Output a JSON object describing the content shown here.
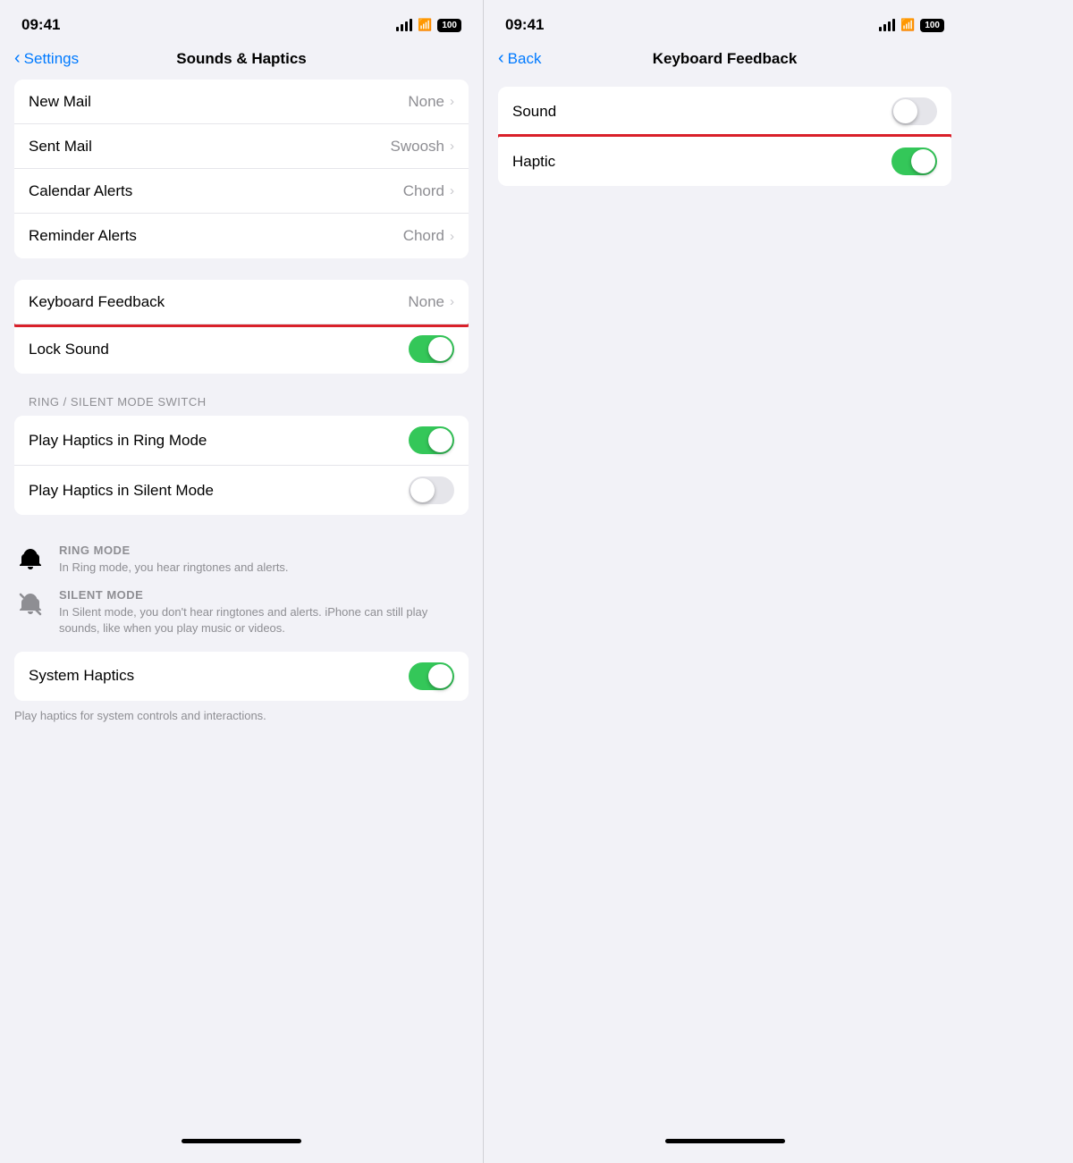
{
  "left": {
    "status": {
      "time": "09:41",
      "battery": "100"
    },
    "nav": {
      "back_label": "Settings",
      "title": "Sounds & Haptics"
    },
    "rows": [
      {
        "id": "new-mail",
        "label": "New Mail",
        "value": "None",
        "type": "chevron",
        "highlighted": false
      },
      {
        "id": "sent-mail",
        "label": "Sent Mail",
        "value": "Swoosh",
        "type": "chevron",
        "highlighted": false
      },
      {
        "id": "calendar-alerts",
        "label": "Calendar Alerts",
        "value": "Chord",
        "type": "chevron",
        "highlighted": false
      },
      {
        "id": "reminder-alerts",
        "label": "Reminder Alerts",
        "value": "Chord",
        "type": "chevron",
        "highlighted": false
      }
    ],
    "rows2": [
      {
        "id": "keyboard-feedback",
        "label": "Keyboard Feedback",
        "value": "None",
        "type": "chevron",
        "highlighted": true
      },
      {
        "id": "lock-sound",
        "label": "Lock Sound",
        "value": "",
        "type": "toggle",
        "toggleOn": true,
        "highlighted": false
      }
    ],
    "section_label": "RING / SILENT MODE SWITCH",
    "rows3": [
      {
        "id": "haptics-ring",
        "label": "Play Haptics in Ring Mode",
        "type": "toggle",
        "toggleOn": true
      },
      {
        "id": "haptics-silent",
        "label": "Play Haptics in Silent Mode",
        "type": "toggle",
        "toggleOn": false
      }
    ],
    "ring_mode": {
      "title": "RING MODE",
      "desc": "In Ring mode, you hear ringtones and alerts."
    },
    "silent_mode": {
      "title": "SILENT MODE",
      "desc": "In Silent mode, you don't hear ringtones and alerts. iPhone can still play sounds, like when you play music or videos."
    },
    "rows4": [
      {
        "id": "system-haptics",
        "label": "System Haptics",
        "type": "toggle",
        "toggleOn": true
      }
    ],
    "system_haptics_desc": "Play haptics for system controls and interactions."
  },
  "right": {
    "status": {
      "time": "09:41",
      "battery": "100"
    },
    "nav": {
      "back_label": "Back",
      "title": "Keyboard Feedback"
    },
    "rows": [
      {
        "id": "sound",
        "label": "Sound",
        "type": "toggle",
        "toggleOn": false,
        "highlighted": false
      },
      {
        "id": "haptic",
        "label": "Haptic",
        "type": "toggle",
        "toggleOn": true,
        "highlighted": true
      }
    ]
  }
}
